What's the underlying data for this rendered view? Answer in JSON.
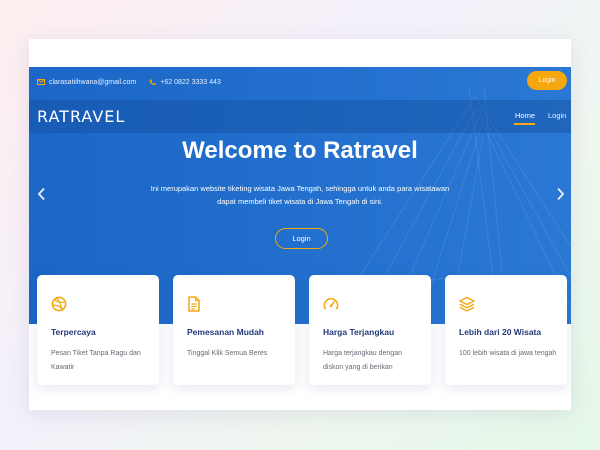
{
  "topbar": {
    "email": "clarasatiihwana@gmail.com",
    "phone": "+62 0822 3333 443",
    "login_label": "Login"
  },
  "navbar": {
    "brand": "RATRAVEL",
    "items": [
      {
        "label": "Home",
        "active": true
      },
      {
        "label": "Login",
        "active": false
      }
    ]
  },
  "hero": {
    "title": "Welcome to Ratravel",
    "description_line1": "Ini merupakan website tiketing wisata Jawa Tengah, sehingga untuk anda para wisatawan",
    "description_line2": "dapat membeli tiket wisata di Jawa Tengah di sini.",
    "button_label": "Login"
  },
  "features": [
    {
      "icon": "dribbble-icon",
      "title": "Terpercaya",
      "text": "Pesan Tiket Tanpa Ragu dan Kawatir"
    },
    {
      "icon": "document-icon",
      "title": "Pemesanan Mudah",
      "text": "Tinggal Klik Semua Beres"
    },
    {
      "icon": "speedometer-icon",
      "title": "Harga Terjangkau",
      "text": "Harga terjangkau dengan diskon yang di berikan"
    },
    {
      "icon": "layers-icon",
      "title": "Lebih dari 20 Wisata",
      "text": "100 lebih wisata di jawa tengah"
    }
  ],
  "colors": {
    "primary": "#1f6fcd",
    "accent": "#f4a70e",
    "card_title": "#243a7a"
  }
}
